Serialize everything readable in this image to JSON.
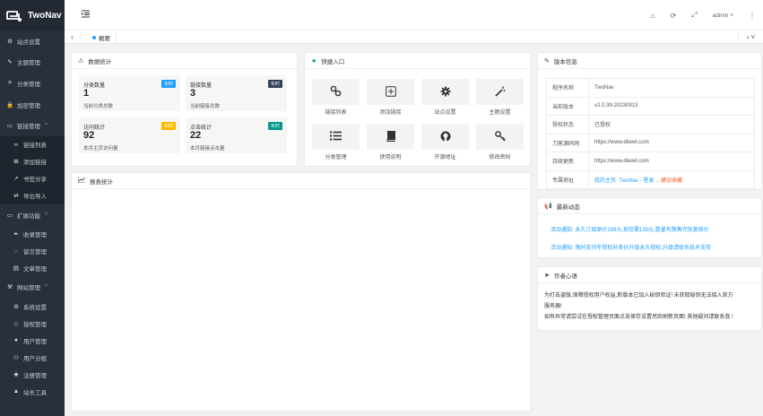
{
  "brand": {
    "name": "TwoNav"
  },
  "header": {
    "user": "admin"
  },
  "sidebar": {
    "items": [
      {
        "label": "站点设置",
        "icon": "gear-icon",
        "sub": false,
        "expand": false
      },
      {
        "label": "主题管理",
        "icon": "brush-icon",
        "sub": false,
        "expand": false
      },
      {
        "label": "分类管理",
        "icon": "list-icon",
        "sub": false,
        "expand": false
      },
      {
        "label": "加密管理",
        "icon": "lock-icon",
        "sub": false,
        "expand": false
      },
      {
        "label": "链接管理",
        "icon": "folder-icon",
        "sub": false,
        "expand": true
      },
      {
        "label": "链接列表",
        "icon": "link-icon",
        "sub": true,
        "expand": false
      },
      {
        "label": "添加链接",
        "icon": "plus-square-icon",
        "sub": true,
        "expand": false
      },
      {
        "label": "书签分享",
        "icon": "share-icon",
        "sub": true,
        "expand": false
      },
      {
        "label": "导出导入",
        "icon": "swap-icon",
        "sub": true,
        "expand": false
      },
      {
        "label": "扩展功能",
        "icon": "folder-icon",
        "sub": false,
        "expand": true
      },
      {
        "label": "收录管理",
        "icon": "pen-icon",
        "sub": true,
        "expand": false
      },
      {
        "label": "留言管理",
        "icon": "chat-icon",
        "sub": true,
        "expand": false
      },
      {
        "label": "文章管理",
        "icon": "file-icon",
        "sub": true,
        "expand": false
      },
      {
        "label": "网站管理",
        "icon": "wrench-icon",
        "sub": false,
        "expand": true
      },
      {
        "label": "系统设置",
        "icon": "cogs-icon",
        "sub": true,
        "expand": false
      },
      {
        "label": "授权管理",
        "icon": "diamond-icon",
        "sub": true,
        "expand": false
      },
      {
        "label": "用户管理",
        "icon": "user-icon",
        "sub": true,
        "expand": false
      },
      {
        "label": "用户分组",
        "icon": "users-icon",
        "sub": true,
        "expand": false
      },
      {
        "label": "注册管理",
        "icon": "user-plus-icon",
        "sub": true,
        "expand": false
      },
      {
        "label": "站长工具",
        "icon": "warning-icon",
        "sub": true,
        "expand": false
      }
    ]
  },
  "tabs": {
    "active": "概要"
  },
  "stats": {
    "title": "数据统计",
    "boxes": [
      {
        "title": "分类数量",
        "badge": "实时",
        "badge_color": "#1e9fff",
        "value": "1",
        "sub": "当前分类总数"
      },
      {
        "title": "链接数量",
        "badge": "实时",
        "badge_color": "#2f4056",
        "value": "3",
        "sub": "当前链接总数"
      },
      {
        "title": "访问统计",
        "badge": "实时",
        "badge_color": "#ffb800",
        "value": "92",
        "sub": "本月主页访问量"
      },
      {
        "title": "点击统计",
        "badge": "实时",
        "badge_color": "#009688",
        "value": "22",
        "sub": "本月链接点击量"
      }
    ]
  },
  "quick": {
    "title": "快捷入口",
    "items": [
      {
        "label": "链接列表",
        "icon": "link-icon"
      },
      {
        "label": "添加链接",
        "icon": "plus-square-icon"
      },
      {
        "label": "站点设置",
        "icon": "gear-icon"
      },
      {
        "label": "主题设置",
        "icon": "magic-wand-icon"
      },
      {
        "label": "分类管理",
        "icon": "list-icon"
      },
      {
        "label": "使用说明",
        "icon": "book-icon"
      },
      {
        "label": "开源地址",
        "icon": "github-icon"
      },
      {
        "label": "修改密码",
        "icon": "key-icon"
      }
    ]
  },
  "report": {
    "title": "报表统计"
  },
  "version": {
    "title": "版本信息",
    "rows": [
      {
        "k": "程序名称",
        "v": "TwoNav"
      },
      {
        "k": "当前版本",
        "v": "v2.0.39-20230913"
      },
      {
        "k": "授权状态",
        "v": "已授权"
      },
      {
        "k": "刀客源码网",
        "v": "https://www.dkewl.com"
      },
      {
        "k": "持续更新",
        "v": "https://www.dkewl.com"
      }
    ],
    "exclusive_label": "专属地址",
    "home": "我的主页",
    "login": "TwoNav - 登录",
    "fav": "建议收藏"
  },
  "news": {
    "title": "最新动态",
    "items": [
      "活动通知: 永久订阅原价199元,现仅需139元,数量有限售完恢复原价",
      "活动通知: 限时支持年授权补差价升级永久授权,升级请联系技术支持"
    ]
  },
  "author": {
    "title": "作者心语",
    "lines": [
      "为打击盗版,保障授权用户权益,新版本已加入秘钥验证! 未获取秘钥无法接入官方",
      "服务器!",
      "如有异常请尝试在授权管理页面点击保存设置然后刷新页面! 其他疑问请联系我 !"
    ]
  }
}
